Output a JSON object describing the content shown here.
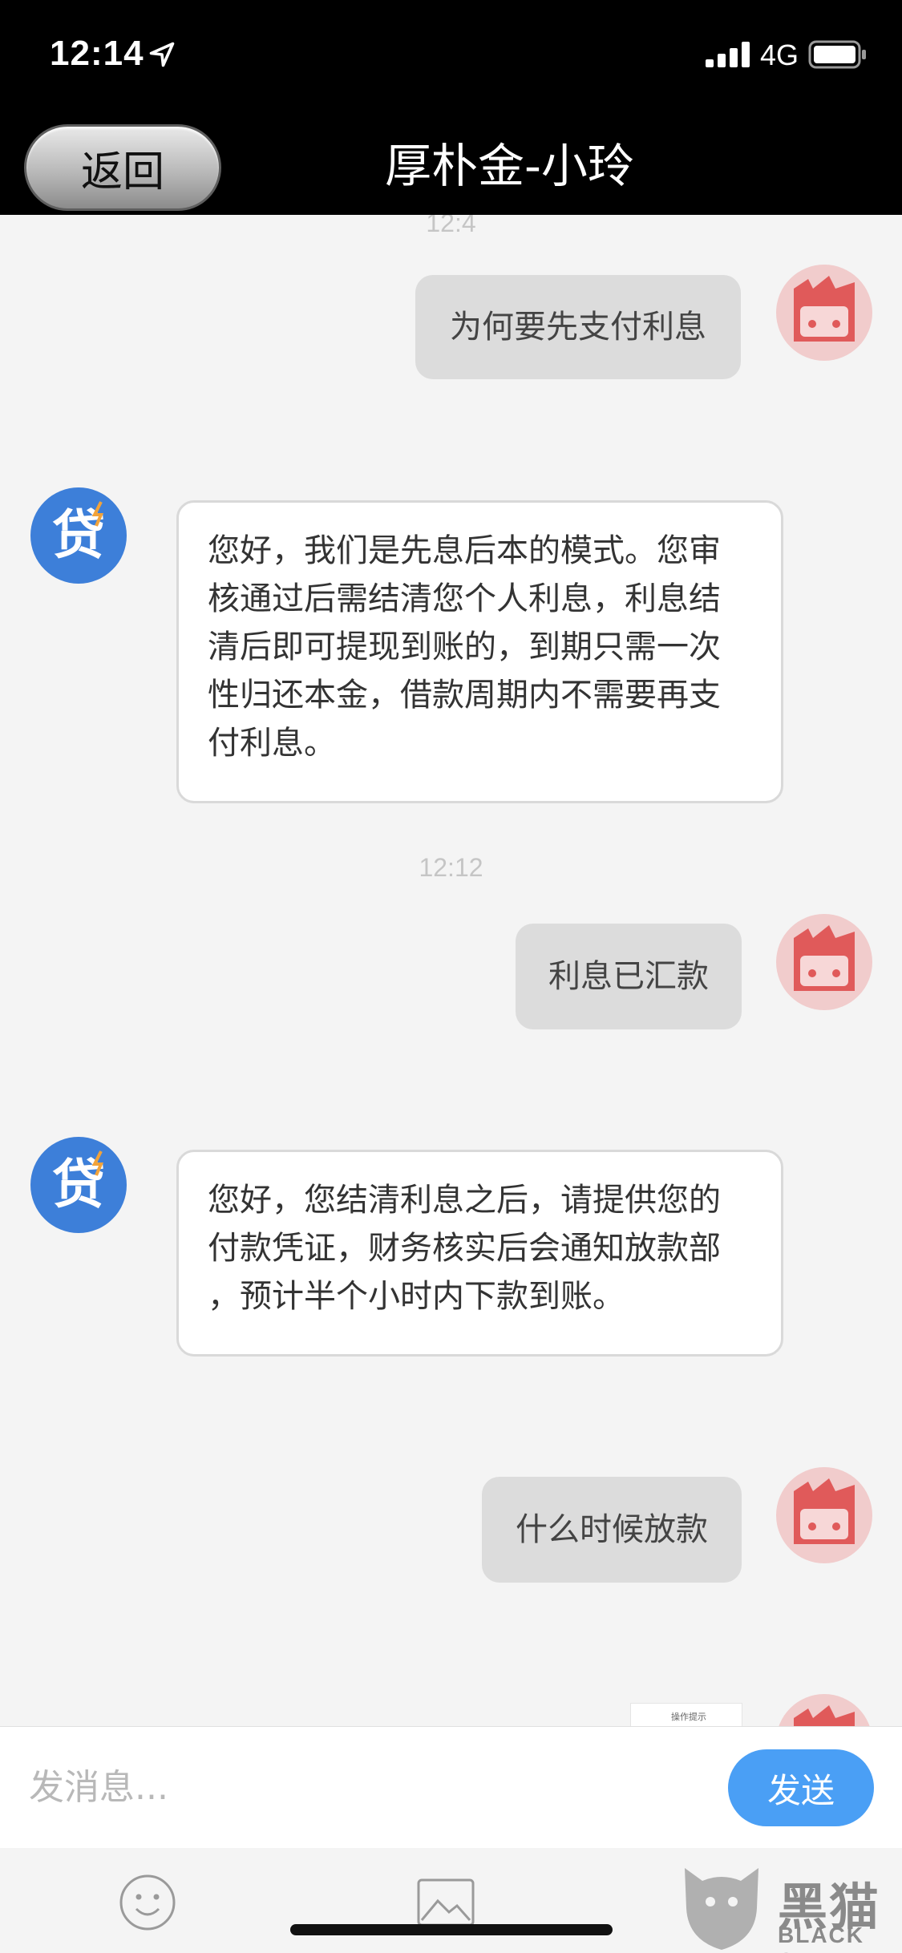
{
  "status_bar": {
    "time": "12:14",
    "network": "4G",
    "icons": [
      "location-arrow-icon",
      "signal-bars-icon",
      "battery-icon"
    ]
  },
  "header": {
    "back_label": "返回",
    "title": "厚朴金-小玲"
  },
  "messages": [
    {
      "type": "timestamp",
      "text": "12:4"
    },
    {
      "type": "outgoing",
      "text": "为何要先支付利息"
    },
    {
      "type": "incoming",
      "lines": [
        "您好，我们是先息后本的模式。您审",
        "核通过后需结清您个人利息，利息结",
        "清后即可提现到账的，到期只需一次",
        "性归还本金，借款周期内不需要再支",
        "付利息。"
      ]
    },
    {
      "type": "timestamp",
      "text": "12:12"
    },
    {
      "type": "outgoing",
      "text": "利息已汇款"
    },
    {
      "type": "incoming",
      "lines": [
        "您好，您结清利息之后，请提供您的",
        "付款凭证，财务核实后会通知放款部",
        "，预计半个小时内下款到账。"
      ]
    },
    {
      "type": "outgoing",
      "text": "什么时候放款"
    },
    {
      "type": "outgoing-image",
      "caption": "操作提示"
    }
  ],
  "avatars": {
    "agent": {
      "icon": "loan-badge-icon",
      "glyph": "贷",
      "color": "#3d7fd9"
    },
    "user": {
      "icon": "cartoon-face-icon",
      "color": "#e05a5a"
    }
  },
  "input_bar": {
    "placeholder": "发消息...",
    "send_label": "发送"
  },
  "toolbar": {
    "icons": [
      "emoji-icon",
      "image-icon"
    ]
  },
  "watermark": {
    "text_cn": "黑猫",
    "text_en": "BLACK CAT"
  },
  "colors": {
    "header_bg": "#000000",
    "chat_bg": "#f4f4f4",
    "outgoing_bubble": "#dcdcdc",
    "incoming_bubble": "#ffffff",
    "send_button": "#4a9ff5",
    "timestamp": "#c5c5c5"
  }
}
